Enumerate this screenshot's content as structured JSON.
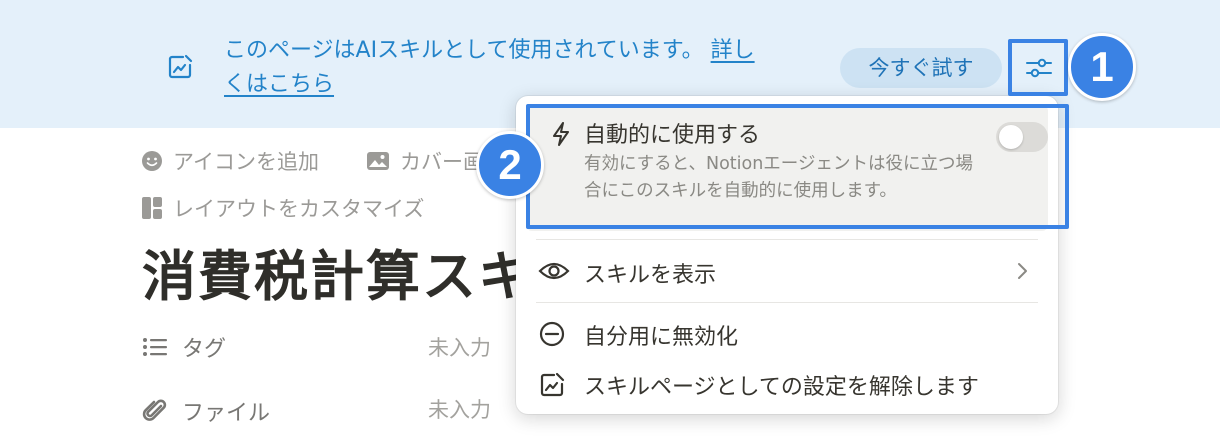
{
  "banner": {
    "message": "このページはAIスキルとして使用されています。",
    "link_part1": "詳し",
    "link_part2": "くはこちら",
    "try_button": "今すぐ試す"
  },
  "callouts": {
    "first": "1",
    "second": "2"
  },
  "page": {
    "add_icon": "アイコンを追加",
    "add_cover": "カバー画",
    "customize_layout": "レイアウトをカスタマイズ",
    "title": "消費税計算スキ",
    "properties": [
      {
        "name": "タグ",
        "value": "未入力",
        "icon": "list-icon"
      },
      {
        "name": "ファイル",
        "value": "未入力",
        "icon": "paperclip-icon"
      }
    ]
  },
  "menu": {
    "auto_use": {
      "title": "自動的に使用する",
      "description": "有効にすると、Notionエージェントは役に立つ場合にこのスキルを自動的に使用します。",
      "enabled": false
    },
    "items": [
      {
        "label": "スキルを表示",
        "icon": "eye-icon",
        "has_submenu": true
      },
      {
        "label": "自分用に無効化",
        "icon": "minus-circle-icon"
      },
      {
        "label": "スキルページとしての設定を解除します",
        "icon": "unlink-page-icon"
      }
    ]
  },
  "colors": {
    "accent": "#2383c9",
    "banner_bg": "#e4f0fa",
    "callout": "#3a82e4"
  }
}
